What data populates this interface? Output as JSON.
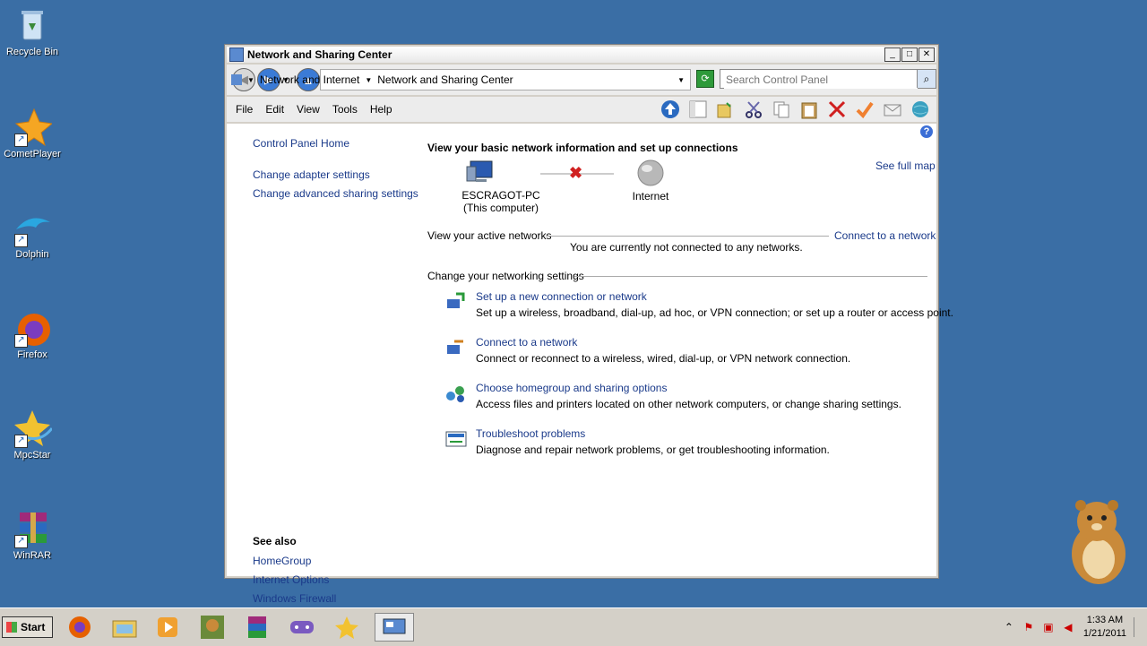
{
  "desktop": {
    "icons": [
      {
        "label": "Recycle Bin",
        "icon": "recycle-bin-icon",
        "color": "#7fb3e0"
      },
      {
        "label": "CometPlayer",
        "icon": "comet-icon",
        "color": "#f5a623"
      },
      {
        "label": "Dolphin",
        "icon": "dolphin-icon",
        "color": "#2aa7e0"
      },
      {
        "label": "Firefox",
        "icon": "firefox-icon",
        "color": "#e66000"
      },
      {
        "label": "MpcStar",
        "icon": "star-icon",
        "color": "#f2c230"
      },
      {
        "label": "WinRAR",
        "icon": "winrar-icon",
        "color": "#8a2a8a"
      }
    ]
  },
  "window": {
    "title": "Network and Sharing Center",
    "controls": {
      "minimize": "_",
      "maximize": "□",
      "close": "✕"
    },
    "breadcrumb": [
      "Network and Internet",
      "Network and Sharing Center"
    ],
    "search_placeholder": "Search Control Panel",
    "menu": [
      "File",
      "Edit",
      "View",
      "Tools",
      "Help"
    ],
    "toolbar_icons": [
      "up-arrow-icon",
      "panel-icon",
      "folder-options-icon",
      "cut-icon",
      "copy-icon",
      "paste-icon",
      "delete-icon",
      "check-icon",
      "mail-icon",
      "globe-icon"
    ]
  },
  "sidebar": {
    "home": "Control Panel Home",
    "links": [
      "Change adapter settings",
      "Change advanced sharing settings"
    ],
    "see_also_title": "See also",
    "see_also": [
      "HomeGroup",
      "Internet Options",
      "Windows Firewall"
    ]
  },
  "main": {
    "heading": "View your basic network information and set up connections",
    "see_full_map": "See full map",
    "computer_name": "ESCRAGOT-PC",
    "computer_sub": "(This computer)",
    "internet_label": "Internet",
    "active_networks_label": "View your active networks",
    "connect_link": "Connect to a network",
    "not_connected": "You are currently not connected to any networks.",
    "change_settings_label": "Change your networking settings",
    "tasks": [
      {
        "title": "Set up a new connection or network",
        "desc": "Set up a wireless, broadband, dial-up, ad hoc, or VPN connection; or set up a router or access point."
      },
      {
        "title": "Connect to a network",
        "desc": "Connect or reconnect to a wireless, wired, dial-up, or VPN network connection."
      },
      {
        "title": "Choose homegroup and sharing options",
        "desc": "Access files and printers located on other network computers, or change sharing settings."
      },
      {
        "title": "Troubleshoot problems",
        "desc": "Diagnose and repair network problems, or get troubleshooting information."
      }
    ]
  },
  "taskbar": {
    "start_label": "Start",
    "clock_time": "1:33 AM",
    "clock_date": "1/21/2011"
  }
}
